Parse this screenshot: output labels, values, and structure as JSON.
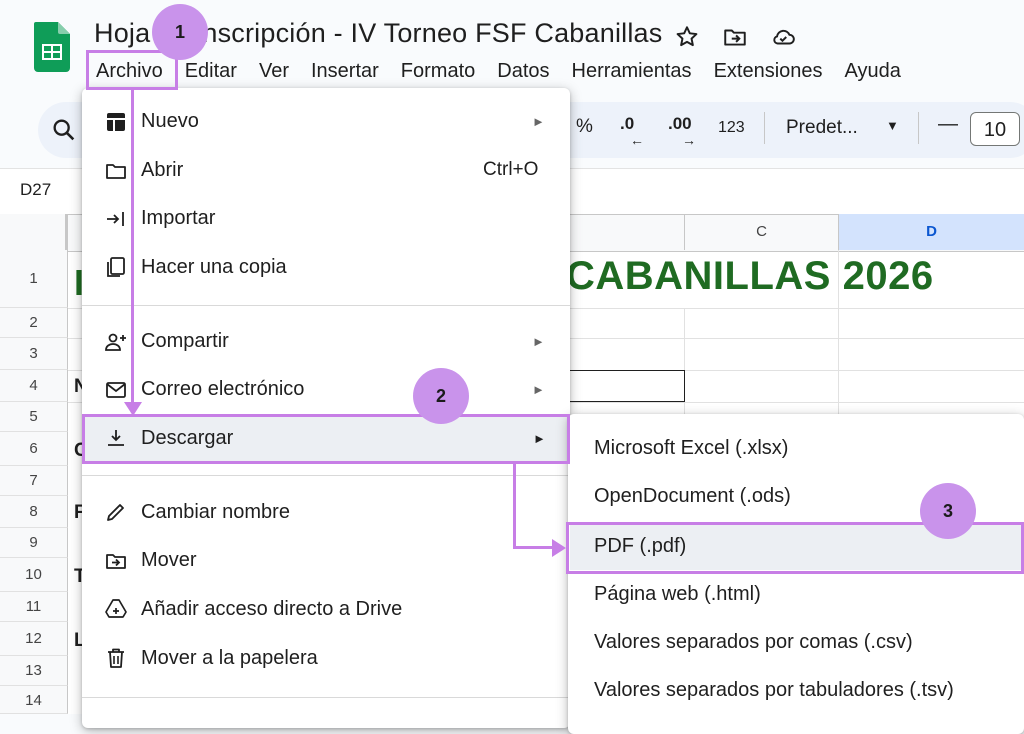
{
  "document": {
    "title": "Hoja de inscripción - IV Torneo FSF Cabanillas"
  },
  "menubar": {
    "items": [
      "Archivo",
      "Editar",
      "Ver",
      "Insertar",
      "Formato",
      "Datos",
      "Herramientas",
      "Extensiones",
      "Ayuda"
    ]
  },
  "toolbar": {
    "percent": "%",
    "decrease_decimals": ".0",
    "increase_decimals": ".00",
    "number_format": "123",
    "font": "Predet...",
    "minus": "—",
    "font_size": "10"
  },
  "name_box": "D27",
  "grid": {
    "columns": [
      "C",
      "D"
    ],
    "rows": [
      "1",
      "2",
      "3",
      "4",
      "5",
      "6",
      "7",
      "8",
      "9",
      "10",
      "11",
      "12",
      "13",
      "14"
    ],
    "banner_text": "CABANILLAS 2026",
    "row_fragments": {
      "1": "I",
      "4": "N",
      "6": "C",
      "8": "F",
      "10": "T",
      "12": "L"
    }
  },
  "file_menu": {
    "items": [
      {
        "label": "Nuevo",
        "icon": "grid-new-icon",
        "submenu": true
      },
      {
        "label": "Abrir",
        "icon": "folder-icon",
        "shortcut": "Ctrl+O"
      },
      {
        "label": "Importar",
        "icon": "import-icon"
      },
      {
        "label": "Hacer una copia",
        "icon": "copy-icon"
      },
      {
        "label": "Compartir",
        "icon": "person-add-icon",
        "submenu": true
      },
      {
        "label": "Correo electrónico",
        "icon": "mail-icon",
        "submenu": true
      },
      {
        "label": "Descargar",
        "icon": "download-icon",
        "submenu": true
      },
      {
        "label": "Cambiar nombre",
        "icon": "pencil-icon"
      },
      {
        "label": "Mover",
        "icon": "move-folder-icon"
      },
      {
        "label": "Añadir acceso directo a Drive",
        "icon": "drive-shortcut-icon"
      },
      {
        "label": "Mover a la papelera",
        "icon": "trash-icon"
      }
    ]
  },
  "download_menu": {
    "items": [
      "Microsoft Excel (.xlsx)",
      "OpenDocument (.ods)",
      "PDF (.pdf)",
      "Página web (.html)",
      "Valores separados por comas (.csv)",
      "Valores separados por tabuladores (.tsv)"
    ]
  },
  "annotations": {
    "steps": [
      "1",
      "2",
      "3"
    ],
    "highlight_color": "#c77ee6",
    "badge_color": "#c993eb"
  },
  "colors": {
    "banner_green": "#1f6b22",
    "sheets_green": "#0f9d58",
    "selected_column": "#d3e3fd"
  }
}
